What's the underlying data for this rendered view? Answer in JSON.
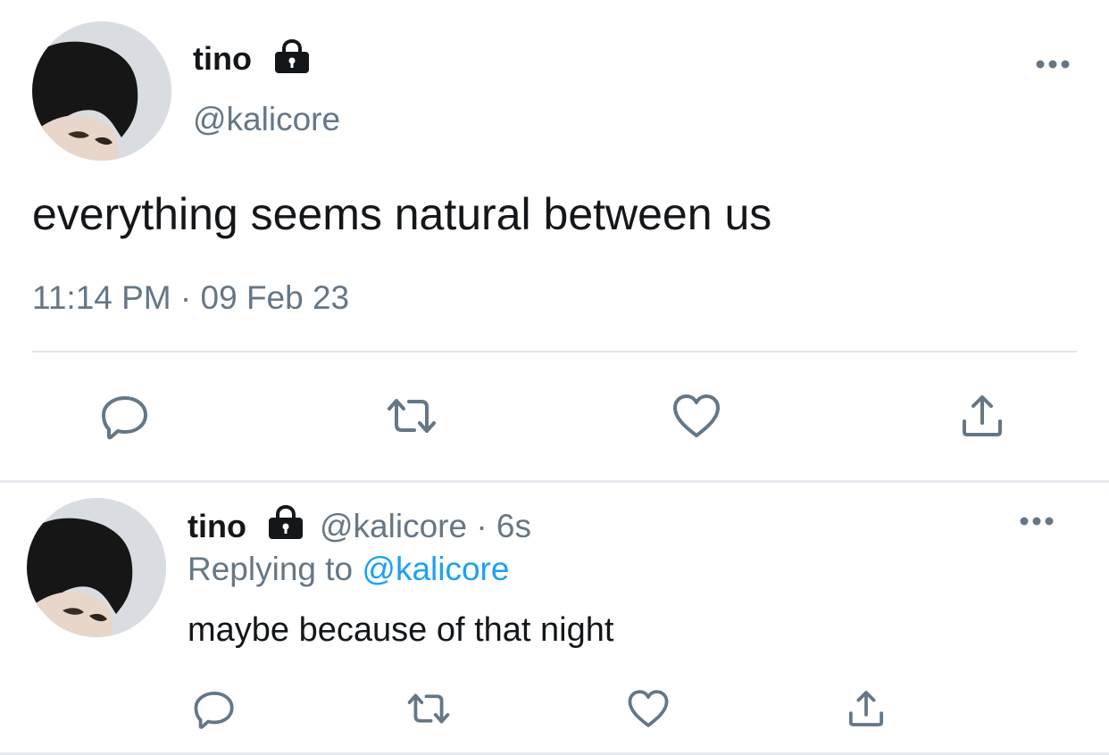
{
  "main_tweet": {
    "display_name": "tino",
    "handle": "@kalicore",
    "text": "everything seems natural between us",
    "timestamp": "11:14 PM · 09 Feb 23",
    "icons": [
      "lock-icon",
      "more-icon",
      "reply-icon",
      "retweet-icon",
      "like-icon",
      "share-icon"
    ]
  },
  "reply_tweet": {
    "display_name": "tino",
    "handle_time": "@kalicore · 6s",
    "replying_prefix": "Replying to",
    "replying_mention": "@kalicore",
    "text": "maybe because of that night",
    "icons": [
      "lock-icon",
      "more-icon",
      "reply-icon",
      "retweet-icon",
      "like-icon",
      "share-icon"
    ]
  },
  "colors": {
    "text_primary": "#14171a",
    "text_secondary": "#657786",
    "link": "#1da1f2",
    "divider": "#e1e8ed"
  }
}
